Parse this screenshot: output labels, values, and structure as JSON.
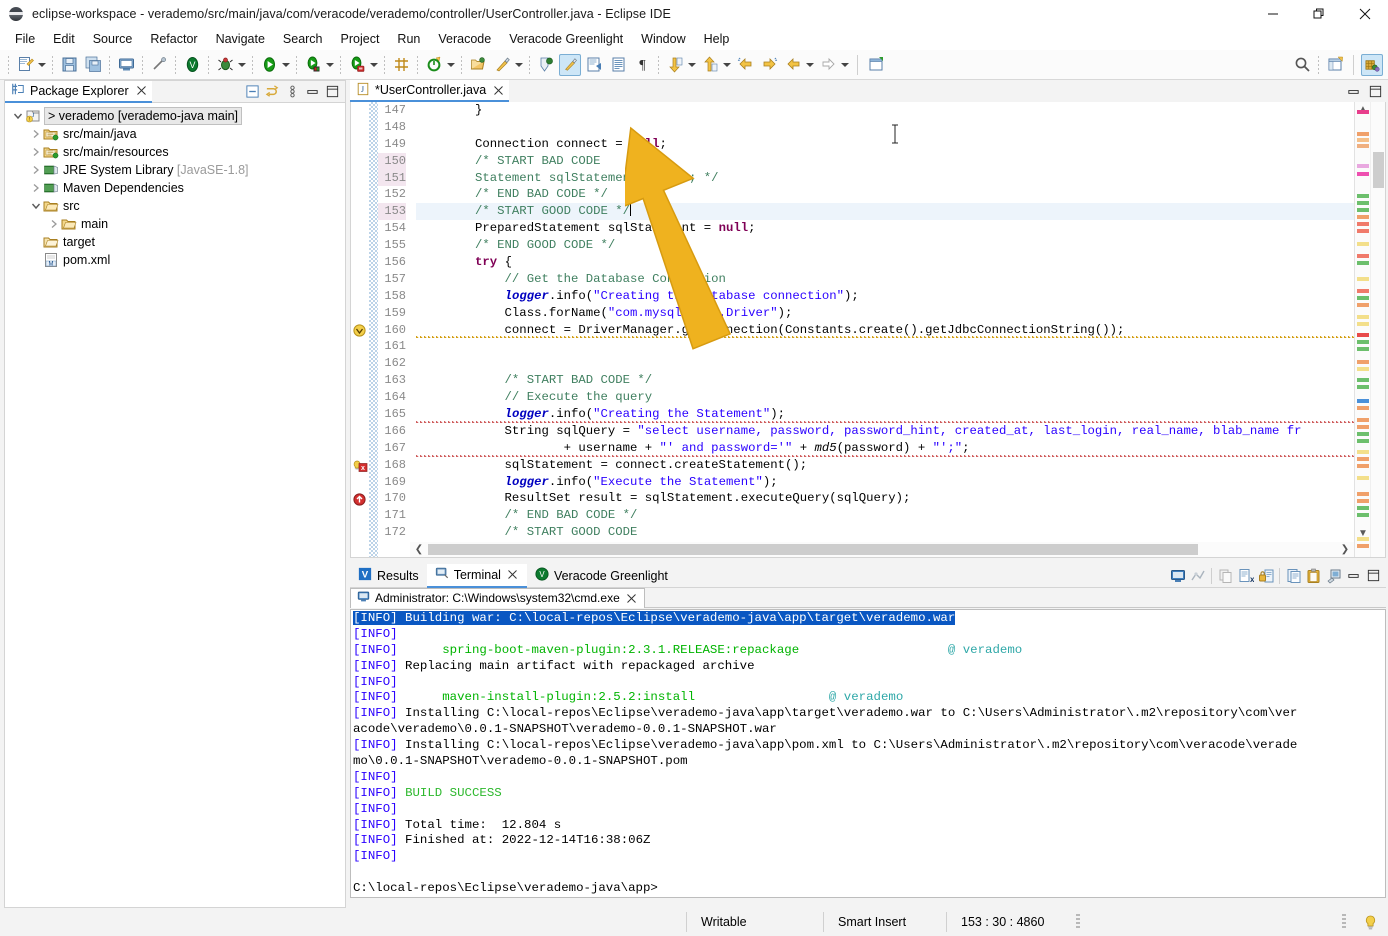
{
  "window": {
    "title": "eclipse-workspace - verademo/src/main/java/com/veracode/verademo/controller/UserController.java - Eclipse IDE",
    "icon": "eclipse-globe-icon",
    "minimize_label": "—",
    "maximize_label": "❐",
    "close_label": "✕"
  },
  "menubar": {
    "items": [
      {
        "label": "File"
      },
      {
        "label": "Edit"
      },
      {
        "label": "Source"
      },
      {
        "label": "Refactor"
      },
      {
        "label": "Navigate"
      },
      {
        "label": "Search"
      },
      {
        "label": "Project"
      },
      {
        "label": "Run"
      },
      {
        "label": "Veracode"
      },
      {
        "label": "Veracode Greenlight"
      },
      {
        "label": "Window"
      },
      {
        "label": "Help"
      }
    ]
  },
  "toolbar": {
    "buttons": [
      {
        "name": "new-wizard-icon"
      },
      {
        "name": "save-icon"
      },
      {
        "name": "save-all-icon"
      },
      {
        "name": "print-icon"
      },
      {
        "name": "toggle-mark-occurrences-icon"
      },
      {
        "name": "veracode-scan-icon"
      },
      {
        "name": "debug-icon"
      },
      {
        "name": "run-icon"
      },
      {
        "name": "run-last-tool-icon"
      },
      {
        "name": "coverage-icon"
      },
      {
        "name": "new-java-package-icon"
      },
      {
        "name": "new-annotation-icon"
      },
      {
        "name": "open-type-icon"
      },
      {
        "name": "external-tools-icon"
      },
      {
        "name": "search-icon"
      },
      {
        "name": "toggle-block-selection-icon"
      },
      {
        "name": "show-whitespace-icon"
      },
      {
        "name": "pilcrow-icon"
      },
      {
        "name": "next-annotation-icon"
      },
      {
        "name": "previous-annotation-icon"
      },
      {
        "name": "back-icon"
      },
      {
        "name": "forward-icon"
      },
      {
        "name": "last-edit-location-icon"
      },
      {
        "name": "new-window-icon"
      },
      {
        "name": "quick-access-search-icon"
      },
      {
        "name": "open-perspective-icon"
      },
      {
        "name": "java-perspective-icon"
      }
    ]
  },
  "package_explorer": {
    "tab_label": "Package Explorer",
    "tab_icon": "package-explorer-icon",
    "close_icon": "close-icon",
    "view_tools": [
      "collapse-all-icon",
      "link-with-editor-icon",
      "view-menu-icon",
      "minimize-icon",
      "maximize-icon"
    ],
    "tree": [
      {
        "label": "verademo [verademo-java main]",
        "icon": "java-project-icon",
        "depth": 0,
        "expanded": true,
        "selected": true,
        "prefix": ">"
      },
      {
        "label": "src/main/java",
        "icon": "source-folder-icon",
        "depth": 1,
        "expanded": false
      },
      {
        "label": "src/main/resources",
        "icon": "source-folder-icon",
        "depth": 1,
        "expanded": false
      },
      {
        "label": "JRE System Library",
        "suffix": "[JavaSE-1.8]",
        "icon": "library-icon",
        "depth": 1,
        "expanded": false
      },
      {
        "label": "Maven Dependencies",
        "icon": "library-icon",
        "depth": 1,
        "expanded": false
      },
      {
        "label": "src",
        "icon": "folder-icon",
        "depth": 1,
        "expanded": true
      },
      {
        "label": "main",
        "icon": "folder-icon",
        "depth": 2,
        "expanded": false
      },
      {
        "label": "target",
        "icon": "folder-plain-icon",
        "depth": 1,
        "leaf": true
      },
      {
        "label": "pom.xml",
        "icon": "xml-file-icon",
        "depth": 1,
        "leaf": true
      }
    ]
  },
  "editor": {
    "tab_label": "*UserController.java",
    "tab_icon": "java-file-icon",
    "close_icon": "close-icon",
    "tools": [
      "minimize-icon",
      "maximize-icon"
    ],
    "first_line": 147,
    "highlight_line": 153,
    "lines": [
      {
        "n": 147,
        "marker": "",
        "tokens": [
          {
            "t": "        }",
            "c": "plain"
          }
        ]
      },
      {
        "n": 148,
        "marker": "",
        "tokens": [
          {
            "t": "",
            "c": "plain"
          }
        ]
      },
      {
        "n": 149,
        "marker": "",
        "tokens": [
          {
            "t": "        Connection connect = ",
            "c": "plain"
          },
          {
            "t": "null",
            "c": "kw"
          },
          {
            "t": ";",
            "c": "plain"
          }
        ]
      },
      {
        "n": 150,
        "marker": "",
        "numhl": true,
        "tokens": [
          {
            "t": "        /* START BAD CODE",
            "c": "cm"
          }
        ]
      },
      {
        "n": 151,
        "marker": "",
        "numhl": true,
        "tokens": [
          {
            "t": "        Statement sqlStatement = null; */",
            "c": "cm"
          }
        ]
      },
      {
        "n": 152,
        "marker": "",
        "tokens": [
          {
            "t": "        /* END BAD CODE */",
            "c": "cm"
          }
        ]
      },
      {
        "n": 153,
        "marker": "",
        "hl": true,
        "numhl": true,
        "caret": true,
        "tokens": [
          {
            "t": "        /* START GOOD CODE */",
            "c": "cm"
          }
        ]
      },
      {
        "n": 154,
        "marker": "",
        "tokens": [
          {
            "t": "        PreparedStatement sqlStatement = ",
            "c": "plain"
          },
          {
            "t": "null",
            "c": "kw"
          },
          {
            "t": ";",
            "c": "plain"
          }
        ]
      },
      {
        "n": 155,
        "marker": "",
        "tokens": [
          {
            "t": "        /* END GOOD CODE */",
            "c": "cm"
          }
        ]
      },
      {
        "n": 156,
        "marker": "",
        "tokens": [
          {
            "t": "        try",
            "c": "kw"
          },
          {
            "t": " {",
            "c": "plain"
          }
        ]
      },
      {
        "n": 157,
        "marker": "",
        "tokens": [
          {
            "t": "            // Get the Database Connection",
            "c": "cm"
          }
        ]
      },
      {
        "n": 158,
        "marker": "",
        "tokens": [
          {
            "t": "            ",
            "c": "plain"
          },
          {
            "t": "logger",
            "c": "fld"
          },
          {
            "t": ".info(",
            "c": "plain"
          },
          {
            "t": "\"Creating the Database connection\"",
            "c": "st"
          },
          {
            "t": ");",
            "c": "plain"
          }
        ]
      },
      {
        "n": 159,
        "marker": "",
        "tokens": [
          {
            "t": "            Class.forName(",
            "c": "plain"
          },
          {
            "t": "\"com.mysql.jdbc.Driver\"",
            "c": "st"
          },
          {
            "t": ");",
            "c": "plain"
          }
        ]
      },
      {
        "n": 160,
        "marker": "warning",
        "tokens": [
          {
            "t": "            connect = DriverManager.getConnection(Constants.create().getJdbcConnectionString());",
            "c": "plain"
          }
        ]
      },
      {
        "n": 161,
        "marker": "",
        "tokens": [
          {
            "t": "",
            "c": "plain"
          }
        ]
      },
      {
        "n": 162,
        "marker": "",
        "tokens": [
          {
            "t": "",
            "c": "plain"
          }
        ]
      },
      {
        "n": 163,
        "marker": "",
        "tokens": [
          {
            "t": "            /* START BAD CODE */",
            "c": "cm"
          }
        ]
      },
      {
        "n": 164,
        "marker": "",
        "tokens": [
          {
            "t": "            // Execute the query",
            "c": "cm"
          }
        ]
      },
      {
        "n": 165,
        "marker": "",
        "tokens": [
          {
            "t": "            ",
            "c": "plain"
          },
          {
            "t": "logger",
            "c": "fld"
          },
          {
            "t": ".info(",
            "c": "plain"
          },
          {
            "t": "\"Creating the Statement\"",
            "c": "st"
          },
          {
            "t": ");",
            "c": "plain"
          }
        ]
      },
      {
        "n": 166,
        "marker": "",
        "tokens": [
          {
            "t": "            String sqlQuery = ",
            "c": "plain"
          },
          {
            "t": "\"select username, password, password_hint, created_at, last_login, real_name, blab_name fr",
            "c": "st"
          }
        ]
      },
      {
        "n": 167,
        "marker": "",
        "tokens": [
          {
            "t": "                    + username + ",
            "c": "plain"
          },
          {
            "t": "\"' and password='\"",
            "c": "st"
          },
          {
            "t": " + ",
            "c": "plain"
          },
          {
            "t": "md5",
            "c": "mth"
          },
          {
            "t": "(password) + ",
            "c": "plain"
          },
          {
            "t": "\"';\"",
            "c": "st"
          },
          {
            "t": ";",
            "c": "plain"
          }
        ]
      },
      {
        "n": 168,
        "marker": "error-quickfix",
        "tokens": [
          {
            "t": "            sqlStatement = connect.createStatement();",
            "c": "plain"
          }
        ]
      },
      {
        "n": 169,
        "marker": "",
        "tokens": [
          {
            "t": "            ",
            "c": "plain"
          },
          {
            "t": "logger",
            "c": "fld"
          },
          {
            "t": ".info(",
            "c": "plain"
          },
          {
            "t": "\"Execute the Statement\"",
            "c": "st"
          },
          {
            "t": ");",
            "c": "plain"
          }
        ]
      },
      {
        "n": 170,
        "marker": "error",
        "tokens": [
          {
            "t": "            ResultSet result = sqlStatement.executeQuery(sqlQuery);",
            "c": "plain"
          }
        ]
      },
      {
        "n": 171,
        "marker": "",
        "tokens": [
          {
            "t": "            /* END BAD CODE */",
            "c": "cm"
          }
        ]
      },
      {
        "n": 172,
        "marker": "",
        "tokens": [
          {
            "t": "            /* START GOOD CODE",
            "c": "cm"
          }
        ]
      }
    ]
  },
  "bottom_panel": {
    "tabs": [
      {
        "label": "Veracode Greenlight",
        "icon": "veracode-icon",
        "active": false,
        "closable": false
      },
      {
        "label": "Terminal",
        "icon": "terminal-icon",
        "active": true,
        "closable": true
      },
      {
        "label": "Results",
        "icon": "results-icon",
        "active": false,
        "closable": false
      }
    ],
    "tools": [
      "open-terminal-icon",
      "toggle-command-input-icon",
      "copy-icon",
      "clear-terminal-icon",
      "scroll-lock-icon",
      "paste-from-clipboard-icon",
      "paste-icon",
      "settings-icon",
      "minimize-icon",
      "maximize-icon"
    ],
    "terminal_tab": {
      "label": "Administrator: C:\\Windows\\system32\\cmd.exe",
      "icon": "console-icon",
      "close_icon": "close-icon"
    },
    "terminal_lines": [
      {
        "segments": [
          {
            "t": "[INFO] Building war: C:\\local-repos\\Eclipse\\verademo-java\\app\\target\\verademo.war",
            "c": "hl-blue"
          }
        ]
      },
      {
        "segments": [
          {
            "t": "[INFO]",
            "c": "info"
          }
        ]
      },
      {
        "segments": [
          {
            "t": "[INFO] ",
            "c": "info"
          },
          {
            "t": "     spring-boot-maven-plugin:2.3.1.RELEASE:repackage",
            "c": "green"
          },
          {
            "t": "                    ",
            "c": "plain"
          },
          {
            "t": "@ verademo",
            "c": "teal"
          }
        ]
      },
      {
        "segments": [
          {
            "t": "[INFO]",
            "c": "info"
          },
          {
            "t": " Replacing main artifact with repackaged archive",
            "c": "plain"
          }
        ]
      },
      {
        "segments": [
          {
            "t": "[INFO]",
            "c": "info"
          }
        ]
      },
      {
        "segments": [
          {
            "t": "[INFO] ",
            "c": "info"
          },
          {
            "t": "     maven-install-plugin:2.5.2:install",
            "c": "green"
          },
          {
            "t": "                  ",
            "c": "plain"
          },
          {
            "t": "@ verademo",
            "c": "teal"
          }
        ]
      },
      {
        "segments": [
          {
            "t": "[INFO]",
            "c": "info"
          },
          {
            "t": " Installing C:\\local-repos\\Eclipse\\verademo-java\\app\\target\\verademo.war to C:\\Users\\Administrator\\.m2\\repository\\com\\ver",
            "c": "plain"
          }
        ]
      },
      {
        "segments": [
          {
            "t": "acode\\verademo\\0.0.1-SNAPSHOT\\verademo-0.0.1-SNAPSHOT.war",
            "c": "plain"
          }
        ]
      },
      {
        "segments": [
          {
            "t": "[INFO]",
            "c": "info"
          },
          {
            "t": " Installing C:\\local-repos\\Eclipse\\verademo-java\\app\\pom.xml to C:\\Users\\Administrator\\.m2\\repository\\com\\veracode\\verade",
            "c": "plain"
          }
        ]
      },
      {
        "segments": [
          {
            "t": "mo\\0.0.1-SNAPSHOT\\verademo-0.0.1-SNAPSHOT.pom",
            "c": "plain"
          }
        ]
      },
      {
        "segments": [
          {
            "t": "[INFO]",
            "c": "info"
          }
        ]
      },
      {
        "segments": [
          {
            "t": "[INFO] ",
            "c": "info"
          },
          {
            "t": "BUILD SUCCESS",
            "c": "lgreen"
          }
        ]
      },
      {
        "segments": [
          {
            "t": "[INFO]",
            "c": "info"
          }
        ]
      },
      {
        "segments": [
          {
            "t": "[INFO]",
            "c": "info"
          },
          {
            "t": " Total time:  12.804 s",
            "c": "plain"
          }
        ]
      },
      {
        "segments": [
          {
            "t": "[INFO]",
            "c": "info"
          },
          {
            "t": " Finished at: 2022-12-14T16:38:06Z",
            "c": "plain"
          }
        ]
      },
      {
        "segments": [
          {
            "t": "[INFO]",
            "c": "info"
          }
        ]
      },
      {
        "segments": [
          {
            "t": "",
            "c": "plain"
          }
        ]
      },
      {
        "segments": [
          {
            "t": "C:\\local-repos\\Eclipse\\verademo-java\\app>",
            "c": "plain"
          }
        ]
      }
    ]
  },
  "statusbar": {
    "writable": "Writable",
    "insert_mode": "Smart Insert",
    "position": "153 : 30 : 4860",
    "bulb_icon": "lightbulb-icon"
  },
  "colors": {
    "accent_tab": "#4a90d9",
    "comment": "#3f7f5f",
    "keyword": "#7f0055",
    "string": "#2a00ff",
    "field": "#0000c0",
    "terminal_info": "#2a00ff",
    "build_success": "#2db82d",
    "highlight_selection": "#0a57c2",
    "pointer_arrow": "#efb21f"
  }
}
